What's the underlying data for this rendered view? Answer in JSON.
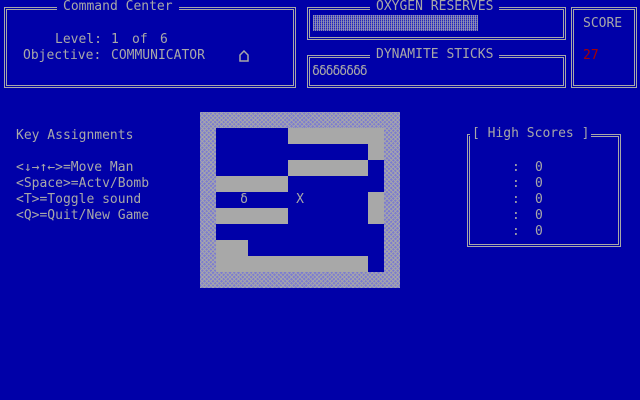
{
  "command_center": {
    "title": "Command Center",
    "level_label": "Level:",
    "level_value": "1",
    "of_label": "of",
    "level_total": "6",
    "objective_label": "Objective:",
    "objective_value": "COMMUNICATOR",
    "objective_icon": "house-icon"
  },
  "oxygen": {
    "title": "OXYGEN RESERVES",
    "level_fraction": 0.68
  },
  "dynamite": {
    "title": "DYNAMITE STICKS",
    "sticks": "δδδδδδδδ"
  },
  "score": {
    "label": "SCORE",
    "value": "27",
    "value_color": "#a80000"
  },
  "keys": {
    "title": "Key Assignments",
    "items": [
      "<↓→↑←>=Move Man",
      "<Space>=Actv/Bomb",
      "<T>=Toggle sound",
      "<Q>=Quit/New Game"
    ]
  },
  "maze": {
    "player_glyph": "δ",
    "target_glyph": "X"
  },
  "high_scores": {
    "title": "[ High Scores ]",
    "entries": [
      {
        "name": "",
        "sep": ":",
        "score": "0"
      },
      {
        "name": "",
        "sep": ":",
        "score": "0"
      },
      {
        "name": "",
        "sep": ":",
        "score": "0"
      },
      {
        "name": "",
        "sep": ":",
        "score": "0"
      },
      {
        "name": "",
        "sep": ":",
        "score": "0"
      }
    ]
  },
  "colors": {
    "background": "#0000a8",
    "foreground": "#a8a8a8",
    "accent_red": "#a80000"
  }
}
